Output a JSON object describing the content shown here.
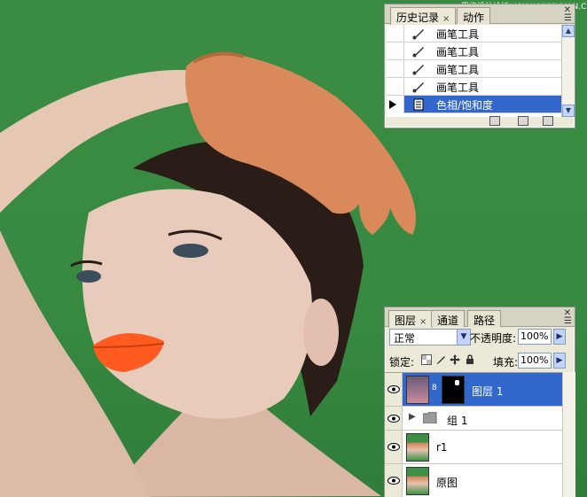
{
  "watermark": "思缘设计论坛  WWW.MISSYUAN.COM",
  "history_panel": {
    "tabs": [
      {
        "label": "历史记录",
        "close": "×"
      },
      {
        "label": "动作",
        "close": ""
      }
    ],
    "rows": [
      {
        "label": "画笔工具",
        "icon": "brush-icon"
      },
      {
        "label": "画笔工具",
        "icon": "brush-icon"
      },
      {
        "label": "画笔工具",
        "icon": "brush-icon"
      },
      {
        "label": "画笔工具",
        "icon": "brush-icon"
      },
      {
        "label": "色相/饱和度",
        "icon": "adjustment-icon",
        "selected": true
      }
    ]
  },
  "layers_panel": {
    "tabs": [
      {
        "label": "图层",
        "close": "×"
      },
      {
        "label": "通道",
        "close": ""
      },
      {
        "label": "路径",
        "close": ""
      }
    ],
    "blend_mode": "正常",
    "opacity_label": "不透明度:",
    "opacity_value": "100%",
    "lock_label": "锁定:",
    "fill_label": "填充:",
    "fill_value": "100%",
    "layers": [
      {
        "name": "图层 1",
        "selected": true,
        "has_mask": true
      },
      {
        "name": "组 1",
        "type": "group"
      },
      {
        "name": "r1"
      },
      {
        "name": "原图"
      }
    ]
  },
  "colors": {
    "accent_selection": "#3267cc",
    "panel_bg": "#ece9d8",
    "canvas_green": "#3a8c43"
  }
}
